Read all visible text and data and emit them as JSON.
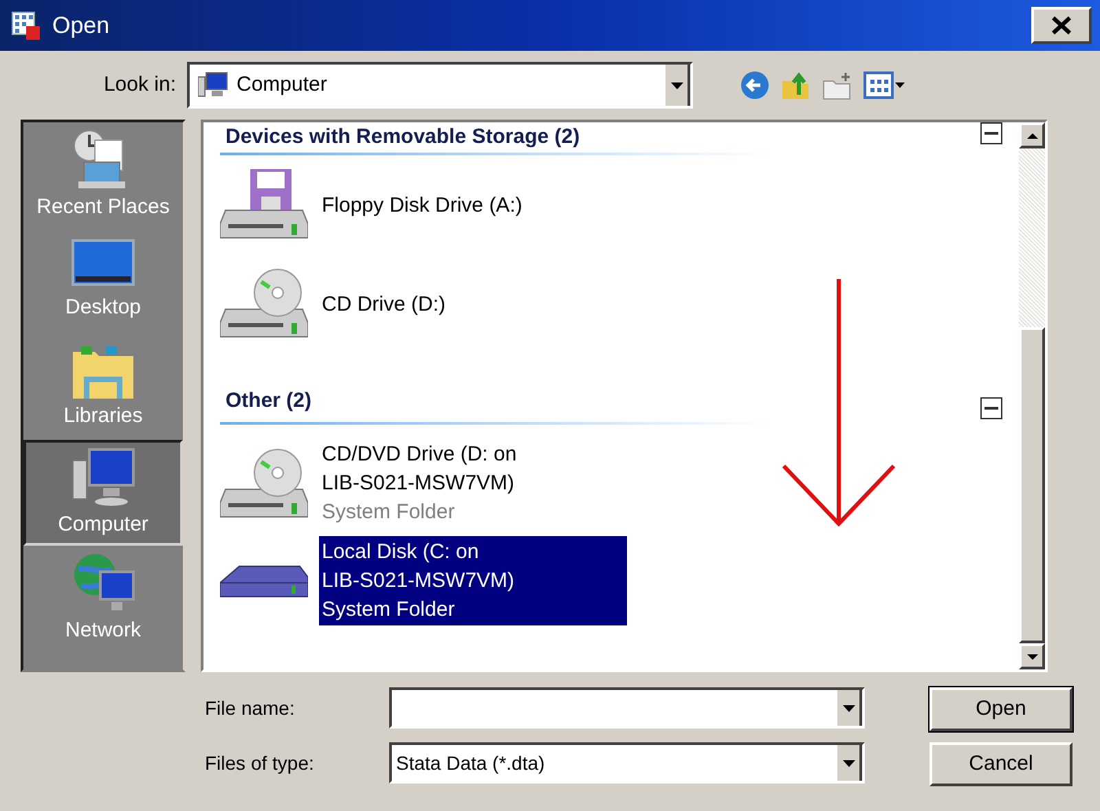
{
  "window": {
    "title": "Open"
  },
  "look_in": {
    "label": "Look in:",
    "value": "Computer"
  },
  "places": [
    {
      "label": "Recent Places",
      "kind": "recent",
      "selected": false
    },
    {
      "label": "Desktop",
      "kind": "desktop",
      "selected": false
    },
    {
      "label": "Libraries",
      "kind": "libraries",
      "selected": false
    },
    {
      "label": "Computer",
      "kind": "computer",
      "selected": true
    },
    {
      "label": "Network",
      "kind": "network",
      "selected": false
    }
  ],
  "groups": [
    {
      "title": "Devices with Removable Storage (2)",
      "expanded": true,
      "items": [
        {
          "kind": "floppy",
          "lines": [
            "Floppy Disk Drive (A:)"
          ],
          "selected": false
        },
        {
          "kind": "cd",
          "lines": [
            "CD Drive (D:)"
          ],
          "selected": false
        }
      ]
    },
    {
      "title": "Other (2)",
      "expanded": true,
      "items": [
        {
          "kind": "cd",
          "lines": [
            "CD/DVD Drive (D: on",
            "LIB-S021-MSW7VM)"
          ],
          "subtitle": "System Folder",
          "selected": false
        },
        {
          "kind": "disk",
          "lines": [
            "Local Disk (C: on",
            "LIB-S021-MSW7VM)"
          ],
          "subtitle": "System Folder",
          "selected": true
        }
      ]
    }
  ],
  "file_name": {
    "label": "File name:"
  },
  "file_type": {
    "label": "Files of type:",
    "value": "Stata Data (*.dta)"
  },
  "buttons": [
    "Open",
    "Cancel"
  ]
}
